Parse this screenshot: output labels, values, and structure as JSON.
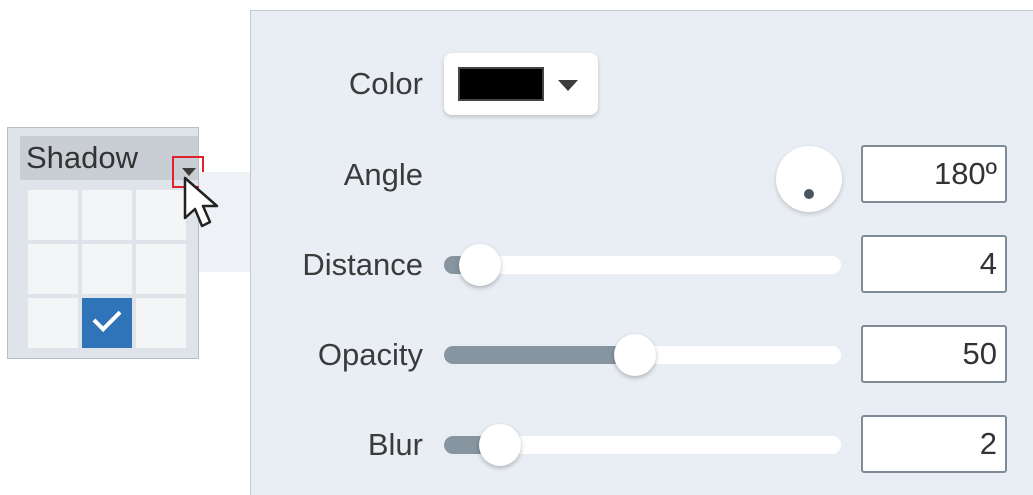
{
  "shadow_widget": {
    "label": "Shadow",
    "grid": {
      "rows": 3,
      "cols": 3,
      "selected_row": 3,
      "selected_col": 2
    }
  },
  "panel": {
    "color": {
      "label": "Color",
      "value": "#000000"
    },
    "angle": {
      "label": "Angle",
      "value": "180º"
    },
    "distance": {
      "label": "Distance",
      "value": "4",
      "slider_fraction": 0.09
    },
    "opacity": {
      "label": "Opacity",
      "value": "50",
      "slider_fraction": 0.48
    },
    "blur": {
      "label": "Blur",
      "value": "2",
      "slider_fraction": 0.14
    }
  },
  "colors": {
    "selection": "#2f74b9",
    "highlight_border": "#e0202a",
    "panel_bg": "#e9eef4"
  },
  "icons": [
    "chevron-down-icon",
    "checkmark-icon",
    "pointer-cursor-icon"
  ]
}
